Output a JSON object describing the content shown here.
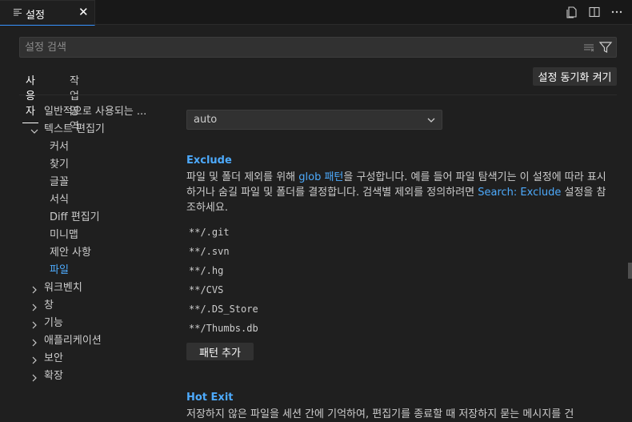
{
  "tab": {
    "label": "설정",
    "close": "✕"
  },
  "search": {
    "placeholder": "설정 검색"
  },
  "scope": {
    "user": "사용자",
    "workspace": "작업 영역"
  },
  "sync_button": "설정 동기화 켜기",
  "toc": [
    {
      "label": "일반적으로 사용되는 ...",
      "chevron": ""
    },
    {
      "label": "텍스트 편집기",
      "chevron": "down"
    },
    {
      "label": "커서",
      "chevron": ""
    },
    {
      "label": "찾기",
      "chevron": ""
    },
    {
      "label": "글꼴",
      "chevron": ""
    },
    {
      "label": "서식",
      "chevron": ""
    },
    {
      "label": "Diff 편집기",
      "chevron": ""
    },
    {
      "label": "미니맵",
      "chevron": ""
    },
    {
      "label": "제안 사항",
      "chevron": ""
    },
    {
      "label": "파일",
      "chevron": "",
      "active": true
    },
    {
      "label": "워크벤치",
      "chevron": "right"
    },
    {
      "label": "창",
      "chevron": "right"
    },
    {
      "label": "기능",
      "chevron": "right"
    },
    {
      "label": "애플리케이션",
      "chevron": "right"
    },
    {
      "label": "보안",
      "chevron": "right"
    },
    {
      "label": "확장",
      "chevron": "right"
    }
  ],
  "dropdown": {
    "value": "auto"
  },
  "exclude": {
    "title": "Exclude",
    "desc_1": "파일 및 폴더 제외를 위해 ",
    "desc_link_1": "glob 패턴",
    "desc_2": "을 구성합니다. 예를 들어 파일 탐색기는 이 설정에 따라 표시하거나 숨길 파일 및 폴더를 결정합니다. 검색별 제외를 정의하려면 ",
    "desc_link_2": "Search: Exclude",
    "desc_3": " 설정을 참조하세요.",
    "patterns": [
      "**/.git",
      "**/.svn",
      "**/.hg",
      "**/CVS",
      "**/.DS_Store",
      "**/Thumbs.db"
    ],
    "add_button": "패턴 추가"
  },
  "hot_exit": {
    "title": "Hot Exit",
    "desc": "저장하지 않은 파일을 세션 간에 기억하여, 편집기를 종료할 때 저장하지 묻는 메시지를 건"
  },
  "colors": {
    "accent": "#4daafc",
    "tab_border": "#3794ff",
    "background": "#1f1f1f"
  },
  "icons": {
    "tab": "settings-file-icon",
    "toolbar": [
      "open-json-icon",
      "split-editor-icon",
      "more-actions-icon"
    ],
    "search": [
      "clear-filter-icon",
      "filter-icon"
    ]
  }
}
